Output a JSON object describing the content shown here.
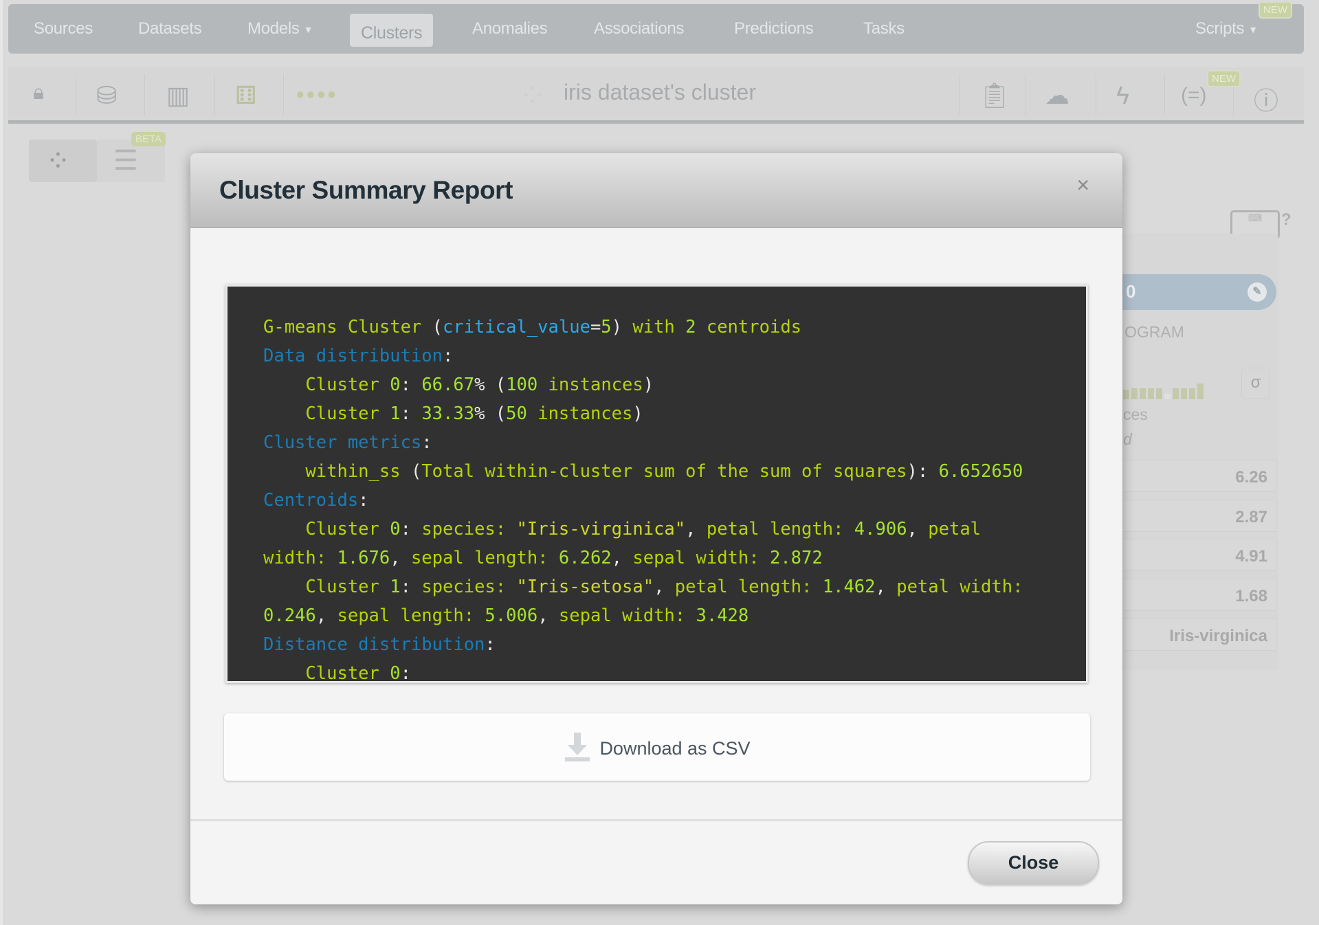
{
  "nav": {
    "items": [
      {
        "label": "Sources",
        "active": false
      },
      {
        "label": "Datasets",
        "active": false
      },
      {
        "label": "Models",
        "active": false,
        "dropdown": true
      },
      {
        "label": "Clusters",
        "active": true
      },
      {
        "label": "Anomalies",
        "active": false
      },
      {
        "label": "Associations",
        "active": false
      },
      {
        "label": "Predictions",
        "active": false
      },
      {
        "label": "Tasks",
        "active": false
      }
    ],
    "scripts_label": "Scripts",
    "new_badge": "NEW"
  },
  "toolbar": {
    "title": "iris dataset's cluster",
    "icons": [
      "lock-icon",
      "dataset-search-icon",
      "chart-search-icon",
      "cluster-options-icon",
      "dots-icon",
      "clipboard-download-icon",
      "cloud-download-icon",
      "lightning-icon",
      "formula-icon",
      "info-icon"
    ],
    "new_badge": "NEW"
  },
  "sidebar": {
    "beta_badge": "BETA"
  },
  "right_panel": {
    "cluster_label": "0",
    "histogram_label": "OGRAM",
    "instances_fragment": "ces",
    "italic_fragment": "d",
    "sigma": "σ",
    "values": [
      "6.26",
      "2.87",
      "4.91",
      "1.68",
      "Iris-virginica"
    ],
    "histogram": [
      0.55,
      0.6,
      0.6,
      0.6,
      0.6,
      0.3,
      0.6,
      0.6,
      0.6,
      0.9
    ]
  },
  "modal": {
    "title": "Cluster Summary Report",
    "close_x": "×",
    "download_label": "Download as CSV",
    "close_label": "Close",
    "report_lines": [
      [
        [
          "text",
          "G-means Cluster "
        ],
        [
          "punc",
          "("
        ],
        [
          "kw",
          "critical_value"
        ],
        [
          "punc",
          "="
        ],
        [
          "num",
          "5"
        ],
        [
          "punc",
          ")"
        ],
        [
          "text",
          " with "
        ],
        [
          "num",
          "2"
        ],
        [
          "text",
          " centroids"
        ]
      ],
      [
        [
          "head",
          "Data distribution"
        ],
        [
          "punc",
          ":"
        ]
      ],
      [
        [
          "text",
          "    Cluster "
        ],
        [
          "num",
          "0"
        ],
        [
          "punc",
          ": "
        ],
        [
          "num",
          "66.67"
        ],
        [
          "punc",
          "% ("
        ],
        [
          "num",
          "100"
        ],
        [
          "text",
          " instances"
        ],
        [
          "punc",
          ")"
        ]
      ],
      [
        [
          "text",
          "    Cluster "
        ],
        [
          "num",
          "1"
        ],
        [
          "punc",
          ": "
        ],
        [
          "num",
          "33.33"
        ],
        [
          "punc",
          "% ("
        ],
        [
          "num",
          "50"
        ],
        [
          "text",
          " instances"
        ],
        [
          "punc",
          ")"
        ]
      ],
      [
        [
          "head",
          "Cluster metrics"
        ],
        [
          "punc",
          ":"
        ]
      ],
      [
        [
          "text",
          "    within_ss "
        ],
        [
          "punc",
          "("
        ],
        [
          "text",
          "Total within-cluster sum of the sum of squares"
        ],
        [
          "punc",
          "): "
        ],
        [
          "num",
          "6.652650"
        ]
      ],
      [
        [
          "head",
          "Centroids"
        ],
        [
          "punc",
          ":"
        ]
      ],
      [
        [
          "text",
          "    Cluster "
        ],
        [
          "num",
          "0"
        ],
        [
          "punc",
          ": "
        ],
        [
          "text",
          "species: "
        ],
        [
          "str",
          "\"Iris-virginica\""
        ],
        [
          "punc",
          ", "
        ],
        [
          "text",
          "petal length: "
        ],
        [
          "num",
          "4.906"
        ],
        [
          "punc",
          ", "
        ],
        [
          "text",
          "petal"
        ]
      ],
      [
        [
          "text",
          "width: "
        ],
        [
          "num",
          "1.676"
        ],
        [
          "punc",
          ", "
        ],
        [
          "text",
          "sepal length: "
        ],
        [
          "num",
          "6.262"
        ],
        [
          "punc",
          ", "
        ],
        [
          "text",
          "sepal width: "
        ],
        [
          "num",
          "2.872"
        ]
      ],
      [
        [
          "text",
          "    Cluster "
        ],
        [
          "num",
          "1"
        ],
        [
          "punc",
          ": "
        ],
        [
          "text",
          "species: "
        ],
        [
          "str",
          "\"Iris-setosa\""
        ],
        [
          "punc",
          ", "
        ],
        [
          "text",
          "petal length: "
        ],
        [
          "num",
          "1.462"
        ],
        [
          "punc",
          ", "
        ],
        [
          "text",
          "petal width:"
        ]
      ],
      [
        [
          "num",
          "0.246"
        ],
        [
          "punc",
          ", "
        ],
        [
          "text",
          "sepal length: "
        ],
        [
          "num",
          "5.006"
        ],
        [
          "punc",
          ", "
        ],
        [
          "text",
          "sepal width: "
        ],
        [
          "num",
          "3.428"
        ]
      ],
      [
        [
          "head",
          "Distance distribution"
        ],
        [
          "punc",
          ":"
        ]
      ],
      [
        [
          "text",
          "    Cluster "
        ],
        [
          "num",
          "0"
        ],
        [
          "punc",
          ":"
        ]
      ]
    ]
  }
}
